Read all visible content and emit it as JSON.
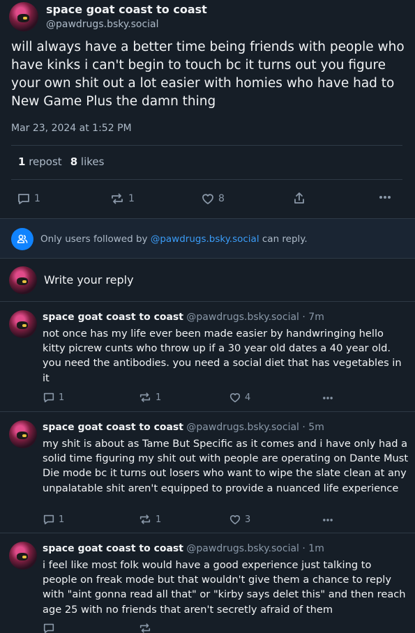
{
  "main_post": {
    "display_name": "space goat coast to coast",
    "handle": "@pawdrugs.bsky.social",
    "text": "will always have a better time being friends with people who have kinks i can't begin to touch bc it turns out you figure your own shit out a lot easier with homies who have had to New Game Plus the damn thing",
    "timestamp": "Mar 23, 2024 at 1:52 PM",
    "repost_count": "1",
    "repost_label": "repost",
    "like_count": "8",
    "like_label": "likes",
    "actions": {
      "reply_count": "1",
      "repost_count": "1",
      "like_count": "8"
    }
  },
  "reply_notice": {
    "prefix": "Only users followed by ",
    "handle": "@pawdrugs.bsky.social",
    "suffix": " can reply."
  },
  "compose": {
    "placeholder": "Write your reply"
  },
  "replies": [
    {
      "display_name": "space goat coast to coast",
      "handle": "@pawdrugs.bsky.social",
      "age": "· 7m",
      "text": "not once has my life ever been made easier by handwringing hello kitty picrew cunts who throw up if a 30 year old dates a 40 year old. you need the antibodies. you need a social diet that has vegetables in it",
      "reply_count": "1",
      "repost_count": "1",
      "like_count": "4"
    },
    {
      "display_name": "space goat coast to coast",
      "handle": "@pawdrugs.bsky.social",
      "age": "· 5m",
      "text": "my shit is about as Tame But Specific as it comes and i have only had a solid time figuring my shit out with people are operating on Dante Must Die mode bc it turns out losers who want to wipe the slate clean at any unpalatable shit aren't equipped to provide a nuanced life experience",
      "reply_count": "1",
      "repost_count": "1",
      "like_count": "3"
    },
    {
      "display_name": "space goat coast to coast",
      "handle": "@pawdrugs.bsky.social",
      "age": "· 1m",
      "text": "i feel like most folk would have a good experience just talking to people on freak mode but that wouldn't give them a chance to reply with \"aint gonna read all that\" or \"kirby says delet this\" and then reach age 25 with no friends that aren't secretly afraid of them",
      "reply_count": "",
      "repost_count": "",
      "like_count": ""
    }
  ],
  "icons": {
    "reply": "speech-bubble-icon",
    "repost": "repost-arrows-icon",
    "like": "heart-icon",
    "share": "share-icon",
    "more": "ellipsis-icon",
    "notice": "people-icon"
  },
  "colors": {
    "background": "#161e27",
    "accent": "#1083fe",
    "link": "#3b9cf7",
    "muted": "#aebbc9"
  }
}
